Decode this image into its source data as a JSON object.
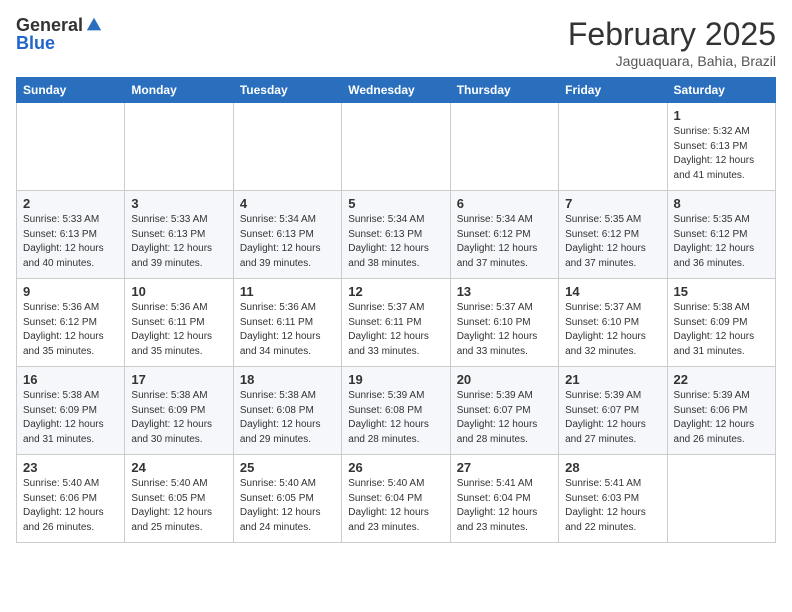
{
  "header": {
    "logo_general": "General",
    "logo_blue": "Blue",
    "month_title": "February 2025",
    "location": "Jaguaquara, Bahia, Brazil"
  },
  "weekdays": [
    "Sunday",
    "Monday",
    "Tuesday",
    "Wednesday",
    "Thursday",
    "Friday",
    "Saturday"
  ],
  "weeks": [
    [
      {
        "day": "",
        "info": ""
      },
      {
        "day": "",
        "info": ""
      },
      {
        "day": "",
        "info": ""
      },
      {
        "day": "",
        "info": ""
      },
      {
        "day": "",
        "info": ""
      },
      {
        "day": "",
        "info": ""
      },
      {
        "day": "1",
        "info": "Sunrise: 5:32 AM\nSunset: 6:13 PM\nDaylight: 12 hours\nand 41 minutes."
      }
    ],
    [
      {
        "day": "2",
        "info": "Sunrise: 5:33 AM\nSunset: 6:13 PM\nDaylight: 12 hours\nand 40 minutes."
      },
      {
        "day": "3",
        "info": "Sunrise: 5:33 AM\nSunset: 6:13 PM\nDaylight: 12 hours\nand 39 minutes."
      },
      {
        "day": "4",
        "info": "Sunrise: 5:34 AM\nSunset: 6:13 PM\nDaylight: 12 hours\nand 39 minutes."
      },
      {
        "day": "5",
        "info": "Sunrise: 5:34 AM\nSunset: 6:13 PM\nDaylight: 12 hours\nand 38 minutes."
      },
      {
        "day": "6",
        "info": "Sunrise: 5:34 AM\nSunset: 6:12 PM\nDaylight: 12 hours\nand 37 minutes."
      },
      {
        "day": "7",
        "info": "Sunrise: 5:35 AM\nSunset: 6:12 PM\nDaylight: 12 hours\nand 37 minutes."
      },
      {
        "day": "8",
        "info": "Sunrise: 5:35 AM\nSunset: 6:12 PM\nDaylight: 12 hours\nand 36 minutes."
      }
    ],
    [
      {
        "day": "9",
        "info": "Sunrise: 5:36 AM\nSunset: 6:12 PM\nDaylight: 12 hours\nand 35 minutes."
      },
      {
        "day": "10",
        "info": "Sunrise: 5:36 AM\nSunset: 6:11 PM\nDaylight: 12 hours\nand 35 minutes."
      },
      {
        "day": "11",
        "info": "Sunrise: 5:36 AM\nSunset: 6:11 PM\nDaylight: 12 hours\nand 34 minutes."
      },
      {
        "day": "12",
        "info": "Sunrise: 5:37 AM\nSunset: 6:11 PM\nDaylight: 12 hours\nand 33 minutes."
      },
      {
        "day": "13",
        "info": "Sunrise: 5:37 AM\nSunset: 6:10 PM\nDaylight: 12 hours\nand 33 minutes."
      },
      {
        "day": "14",
        "info": "Sunrise: 5:37 AM\nSunset: 6:10 PM\nDaylight: 12 hours\nand 32 minutes."
      },
      {
        "day": "15",
        "info": "Sunrise: 5:38 AM\nSunset: 6:09 PM\nDaylight: 12 hours\nand 31 minutes."
      }
    ],
    [
      {
        "day": "16",
        "info": "Sunrise: 5:38 AM\nSunset: 6:09 PM\nDaylight: 12 hours\nand 31 minutes."
      },
      {
        "day": "17",
        "info": "Sunrise: 5:38 AM\nSunset: 6:09 PM\nDaylight: 12 hours\nand 30 minutes."
      },
      {
        "day": "18",
        "info": "Sunrise: 5:38 AM\nSunset: 6:08 PM\nDaylight: 12 hours\nand 29 minutes."
      },
      {
        "day": "19",
        "info": "Sunrise: 5:39 AM\nSunset: 6:08 PM\nDaylight: 12 hours\nand 28 minutes."
      },
      {
        "day": "20",
        "info": "Sunrise: 5:39 AM\nSunset: 6:07 PM\nDaylight: 12 hours\nand 28 minutes."
      },
      {
        "day": "21",
        "info": "Sunrise: 5:39 AM\nSunset: 6:07 PM\nDaylight: 12 hours\nand 27 minutes."
      },
      {
        "day": "22",
        "info": "Sunrise: 5:39 AM\nSunset: 6:06 PM\nDaylight: 12 hours\nand 26 minutes."
      }
    ],
    [
      {
        "day": "23",
        "info": "Sunrise: 5:40 AM\nSunset: 6:06 PM\nDaylight: 12 hours\nand 26 minutes."
      },
      {
        "day": "24",
        "info": "Sunrise: 5:40 AM\nSunset: 6:05 PM\nDaylight: 12 hours\nand 25 minutes."
      },
      {
        "day": "25",
        "info": "Sunrise: 5:40 AM\nSunset: 6:05 PM\nDaylight: 12 hours\nand 24 minutes."
      },
      {
        "day": "26",
        "info": "Sunrise: 5:40 AM\nSunset: 6:04 PM\nDaylight: 12 hours\nand 23 minutes."
      },
      {
        "day": "27",
        "info": "Sunrise: 5:41 AM\nSunset: 6:04 PM\nDaylight: 12 hours\nand 23 minutes."
      },
      {
        "day": "28",
        "info": "Sunrise: 5:41 AM\nSunset: 6:03 PM\nDaylight: 12 hours\nand 22 minutes."
      },
      {
        "day": "",
        "info": ""
      }
    ]
  ]
}
